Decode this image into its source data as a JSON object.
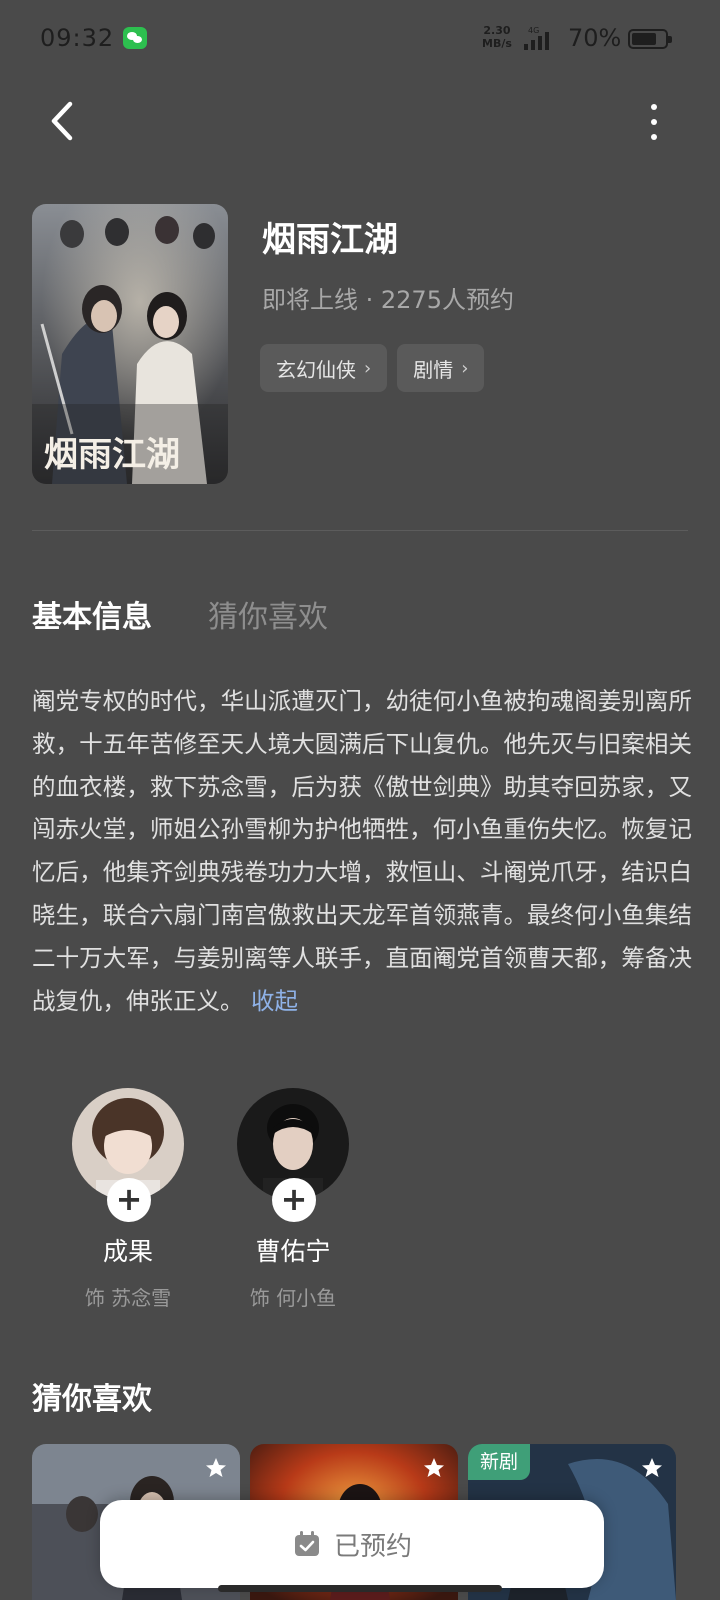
{
  "status_bar": {
    "time": "09:32",
    "net_speed_value": "2.30",
    "net_speed_unit": "MB/s",
    "signal_label": "4G",
    "battery": "70%"
  },
  "header": {
    "title": "烟雨江湖",
    "meta": "即将上线 · 2275人预约",
    "tags": [
      {
        "label": "玄幻仙侠"
      },
      {
        "label": "剧情"
      }
    ],
    "poster_title": "烟雨江湖"
  },
  "tabs": {
    "basic": "基本信息",
    "recommend": "猜你喜欢"
  },
  "synopsis": {
    "text": "阉党专权的时代，华山派遭灭门，幼徒何小鱼被拘魂阁姜别离所救，十五年苦修至天人境大圆满后下山复仇。他先灭与旧案相关的血衣楼，救下苏念雪，后为获《傲世剑典》助其夺回苏家，又闯赤火堂，师姐公孙雪柳为护他牺牲，何小鱼重伤失忆。恢复记忆后，他集齐剑典残卷功力大增，救恒山、斗阉党爪牙，结识白晓生，联合六扇门南宫傲救出天龙军首领燕青。最终何小鱼集结二十万大军，与姜别离等人联手，直面阉党首领曹天都，筹备决战复仇，伸张正义。",
    "collapse_label": "收起"
  },
  "cast": [
    {
      "name": "成果",
      "role": "饰 苏念雪"
    },
    {
      "name": "曹佑宁",
      "role": "饰 何小鱼"
    }
  ],
  "recommend": {
    "title": "猜你喜欢",
    "cards": [
      {
        "badge": ""
      },
      {
        "badge": ""
      },
      {
        "badge": "新剧"
      }
    ]
  },
  "bottom": {
    "reserved_label": "已预约"
  }
}
